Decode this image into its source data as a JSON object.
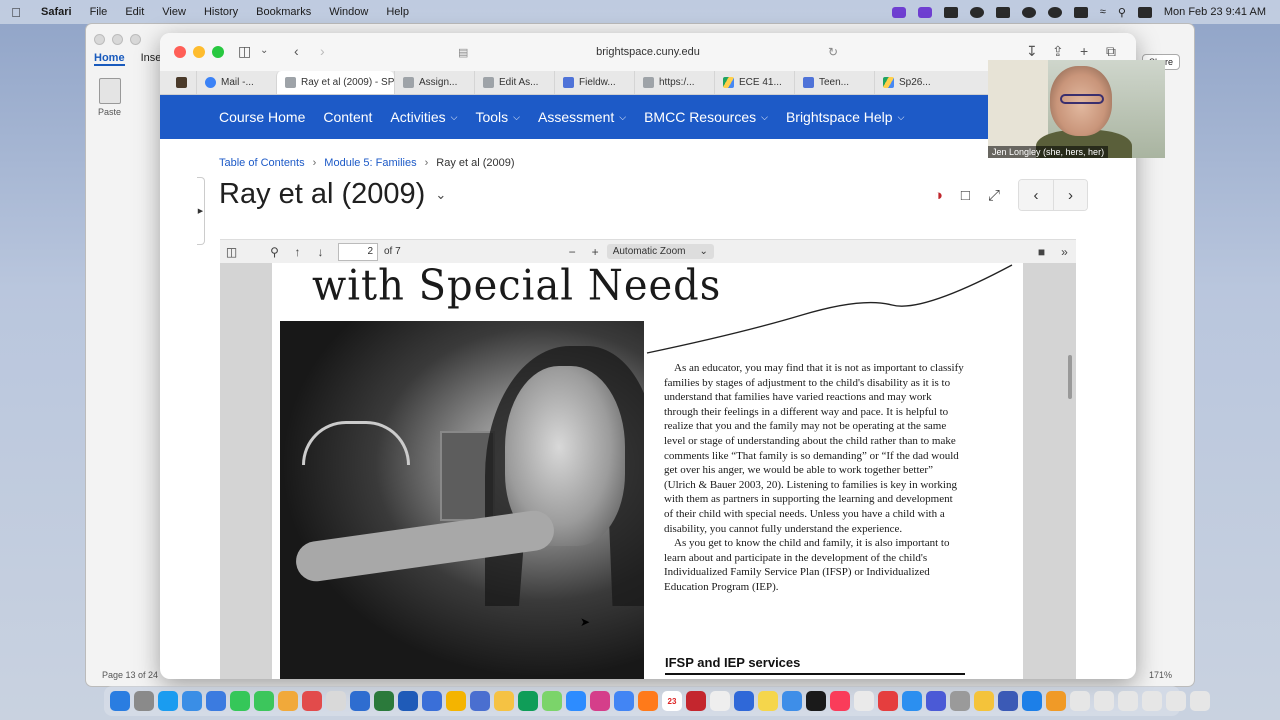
{
  "menubar": {
    "app": "Safari",
    "menus": [
      "File",
      "Edit",
      "View",
      "History",
      "Bookmarks",
      "Window",
      "Help"
    ],
    "datetime": "Mon Feb 23  9:41 AM"
  },
  "word": {
    "tabs": [
      "Home",
      "Inser"
    ],
    "paste_label": "Paste",
    "status": "Page 13 of 24",
    "zoom": "171%",
    "share": "Share"
  },
  "safari": {
    "url": "brightspace.cuny.edu",
    "tabs": [
      {
        "label": "",
        "fav": "p"
      },
      {
        "label": "Mail -...",
        "fav": "m"
      },
      {
        "label": "Ray et al (2009) - SP...",
        "fav": "c",
        "active": true
      },
      {
        "label": "Assign...",
        "fav": "c"
      },
      {
        "label": "Edit As...",
        "fav": "c"
      },
      {
        "label": "Fieldw...",
        "fav": "d"
      },
      {
        "label": "https:/...",
        "fav": "c"
      },
      {
        "label": "ECE 41...",
        "fav": "gd"
      },
      {
        "label": "Teen...",
        "fav": "d"
      },
      {
        "label": "Sp26...",
        "fav": "gd"
      }
    ]
  },
  "nav": {
    "items": [
      {
        "label": "Course Home",
        "dropdown": false
      },
      {
        "label": "Content",
        "dropdown": false
      },
      {
        "label": "Activities",
        "dropdown": true
      },
      {
        "label": "Tools",
        "dropdown": true
      },
      {
        "label": "Assessment",
        "dropdown": true
      },
      {
        "label": "BMCC Resources",
        "dropdown": true
      },
      {
        "label": "Brightspace Help",
        "dropdown": true
      }
    ]
  },
  "breadcrumb": {
    "toc": "Table of Contents",
    "module": "Module 5: Families",
    "current": "Ray et al (2009)"
  },
  "page": {
    "title": "Ray et al (2009)"
  },
  "pdf": {
    "page_number": "2",
    "page_count": "of 7",
    "zoom": "Automatic Zoom",
    "heading_fragment": "with Special Needs",
    "paragraphs": [
      "As an educator, you may find that it is not as important to classify families by stages of adjustment to the child's disability as it is to understand that families have varied reactions and may work through their feelings in a different way and pace. It is helpful to realize that you and the family may not be operating at the same level or stage of understanding about the child rather than to make comments like “That family is so demanding” or “If the dad would get over his anger, we would be able to work together better” (Ulrich & Bauer 2003, 20). Listening to families is key in working with them as partners in supporting the learning and development of their child with special needs. Unless you have a child with a disability, you cannot fully understand the experience.",
      "As you get to know the child and family, it is also important to learn about and participate in the development of the child's Individualized Family Service Plan (IFSP) or Individualized Education Program (IEP)."
    ],
    "subheading": "IFSP and IEP services"
  },
  "video": {
    "name": "Jen Longley (she, hers, her)"
  },
  "dock": {
    "calendar_day": "23"
  }
}
